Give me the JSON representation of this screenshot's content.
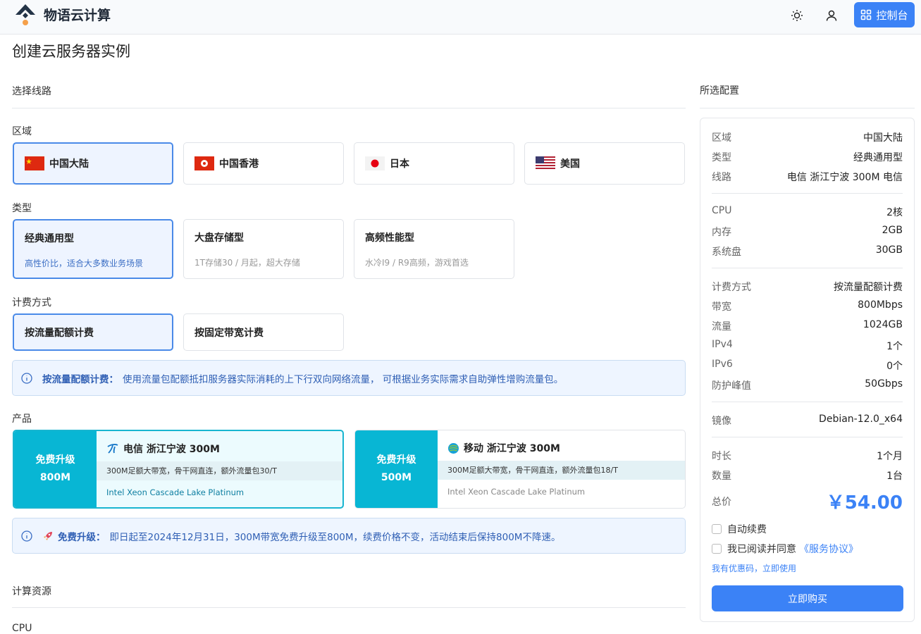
{
  "app": {
    "name": "物语云计算"
  },
  "header": {
    "console_label": "控制台"
  },
  "page": {
    "title": "创建云服务器实例"
  },
  "sections": {
    "route": "选择线路",
    "compute": "计算资源",
    "cpu_label": "CPU"
  },
  "region": {
    "label": "区域",
    "options": [
      {
        "name": "中国大陆",
        "flag": "cn",
        "selected": true
      },
      {
        "name": "中国香港",
        "flag": "hk",
        "selected": false
      },
      {
        "name": "日本",
        "flag": "jp",
        "selected": false
      },
      {
        "name": "美国",
        "flag": "us",
        "selected": false
      }
    ]
  },
  "type": {
    "label": "类型",
    "options": [
      {
        "name": "经典通用型",
        "desc": "高性价比，适合大多数业务场景",
        "selected": true
      },
      {
        "name": "大盘存储型",
        "desc": "1T存储30 / 月起，超大存储",
        "selected": false
      },
      {
        "name": "高频性能型",
        "desc": "水冷I9 / R9高频，游戏首选",
        "selected": false
      }
    ]
  },
  "billing": {
    "label": "计费方式",
    "options": [
      {
        "name": "按流量配额计费",
        "selected": true
      },
      {
        "name": "按固定带宽计费",
        "selected": false
      }
    ],
    "info_title": "按流量配额计费：",
    "info_text": "使用流量包配额抵扣服务器实际消耗的上下行双向网络流量， 可根据业务实际需求自助弹性增购流量包。"
  },
  "product": {
    "label": "产品",
    "options": [
      {
        "badge_line1": "免费升级",
        "badge_line2": "800M",
        "title": "电信 浙江宁波 300M",
        "desc": "300M足额大带宽，骨干网直连，额外流量包30/T",
        "cpu": "Intel Xeon Cascade Lake Platinum",
        "icon": "china-telecom-icon",
        "selected": true
      },
      {
        "badge_line1": "免费升级",
        "badge_line2": "500M",
        "title": "移动 浙江宁波 300M",
        "desc": "300M足额大带宽，骨干网直连，额外流量包18/T",
        "cpu": "Intel Xeon Cascade Lake Platinum",
        "icon": "china-mobile-icon",
        "selected": false
      }
    ],
    "promo_title": "免费升级：",
    "promo_text": "即日起至2024年12月31日，300M带宽免费升级至800M，续费价格不变，活动结束后保持800M不降速。"
  },
  "summary": {
    "title": "所选配置",
    "groups": [
      [
        {
          "k": "区域",
          "v": "中国大陆"
        },
        {
          "k": "类型",
          "v": "经典通用型"
        },
        {
          "k": "线路",
          "v": "电信 浙江宁波 300M 电信"
        }
      ],
      [
        {
          "k": "CPU",
          "v": "2核"
        },
        {
          "k": "内存",
          "v": "2GB"
        },
        {
          "k": "系统盘",
          "v": "30GB"
        }
      ],
      [
        {
          "k": "计费方式",
          "v": "按流量配额计费"
        },
        {
          "k": "带宽",
          "v": "800Mbps"
        },
        {
          "k": "流量",
          "v": "1024GB"
        },
        {
          "k": "IPv4",
          "v": "1个"
        },
        {
          "k": "IPv6",
          "v": "0个"
        },
        {
          "k": "防护峰值",
          "v": "50Gbps"
        }
      ],
      [
        {
          "k": "镜像",
          "v": "Debian-12.0_x64"
        }
      ],
      [
        {
          "k": "时长",
          "v": "1个月"
        },
        {
          "k": "数量",
          "v": "1台"
        }
      ]
    ],
    "total_label": "总价",
    "total_value": "￥54.00",
    "auto_renew": "自动续费",
    "agree_prefix": "我已阅读并同意",
    "agree_link": "《服务协议》",
    "coupon": "我有优惠码，立即使用",
    "buy": "立即购买"
  },
  "colors": {
    "accent": "#3b82f6",
    "product_badge": "#08b6d4"
  }
}
